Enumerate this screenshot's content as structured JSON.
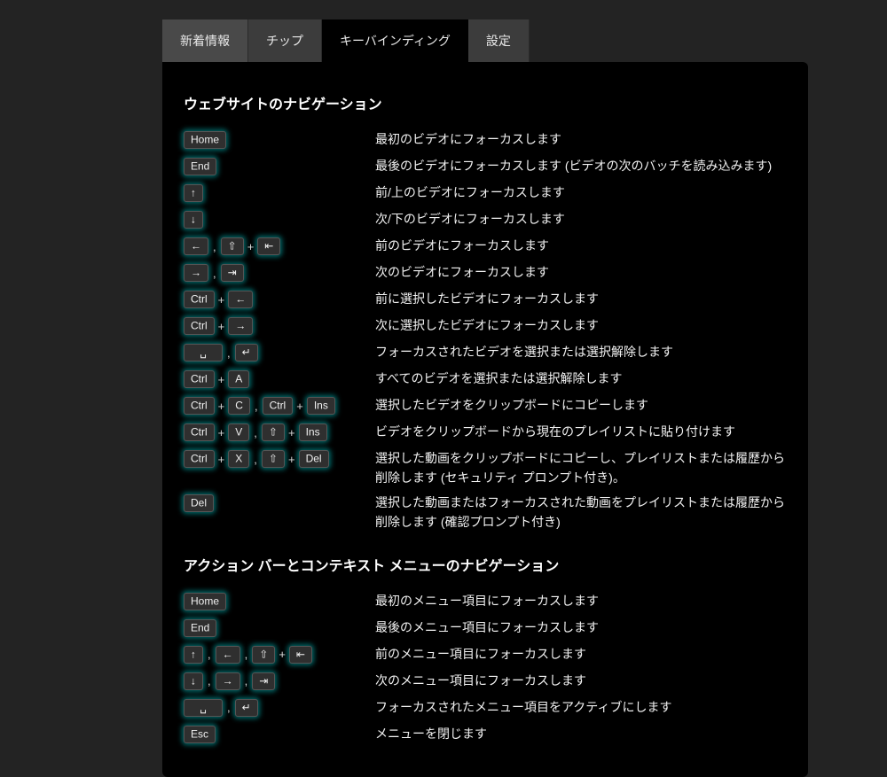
{
  "tabs": [
    {
      "label": "新着情報",
      "active": false
    },
    {
      "label": "チップ",
      "active": false
    },
    {
      "label": "キーバインディング",
      "active": true
    },
    {
      "label": "設定",
      "active": false
    }
  ],
  "sections": [
    {
      "title": "ウェブサイトのナビゲーション",
      "rows": [
        {
          "keys": [
            [
              "Home"
            ]
          ],
          "desc": "最初のビデオにフォーカスします"
        },
        {
          "keys": [
            [
              "End"
            ]
          ],
          "desc": "最後のビデオにフォーカスします (ビデオの次のバッチを読み込みます)"
        },
        {
          "keys": [
            [
              "↑"
            ]
          ],
          "desc": "前/上のビデオにフォーカスします"
        },
        {
          "keys": [
            [
              "↓"
            ]
          ],
          "desc": "次/下のビデオにフォーカスします"
        },
        {
          "keys": [
            [
              "←"
            ],
            [
              "⇧",
              "⇤"
            ]
          ],
          "desc": "前のビデオにフォーカスします"
        },
        {
          "keys": [
            [
              "→"
            ],
            [
              "⇥"
            ]
          ],
          "desc": "次のビデオにフォーカスします"
        },
        {
          "keys": [
            [
              "Ctrl",
              "←"
            ]
          ],
          "desc": "前に選択したビデオにフォーカスします"
        },
        {
          "keys": [
            [
              "Ctrl",
              "→"
            ]
          ],
          "desc": "次に選択したビデオにフォーカスします"
        },
        {
          "keys": [
            [
              "␣"
            ],
            [
              "↵"
            ]
          ],
          "desc": "フォーカスされたビデオを選択または選択解除します"
        },
        {
          "keys": [
            [
              "Ctrl",
              "A"
            ]
          ],
          "desc": "すべてのビデオを選択または選択解除します"
        },
        {
          "keys": [
            [
              "Ctrl",
              "C"
            ],
            [
              "Ctrl",
              "Ins"
            ]
          ],
          "desc": "選択したビデオをクリップボードにコピーします"
        },
        {
          "keys": [
            [
              "Ctrl",
              "V"
            ],
            [
              "⇧",
              "Ins"
            ]
          ],
          "desc": "ビデオをクリップボードから現在のプレイリストに貼り付けます"
        },
        {
          "keys": [
            [
              "Ctrl",
              "X"
            ],
            [
              "⇧",
              "Del"
            ]
          ],
          "desc": "選択した動画をクリップボードにコピーし、プレイリストまたは履歴から削除します (セキュリティ プロンプト付き)。"
        },
        {
          "keys": [
            [
              "Del"
            ]
          ],
          "desc": "選択した動画またはフォーカスされた動画をプレイリストまたは履歴から削除します (確認プロンプト付き)"
        }
      ]
    },
    {
      "title": "アクション バーとコンテキスト メニューのナビゲーション",
      "rows": [
        {
          "keys": [
            [
              "Home"
            ]
          ],
          "desc": "最初のメニュー項目にフォーカスします"
        },
        {
          "keys": [
            [
              "End"
            ]
          ],
          "desc": "最後のメニュー項目にフォーカスします"
        },
        {
          "keys": [
            [
              "↑"
            ],
            [
              "←"
            ],
            [
              "⇧",
              "⇤"
            ]
          ],
          "desc": "前のメニュー項目にフォーカスします"
        },
        {
          "keys": [
            [
              "↓"
            ],
            [
              "→"
            ],
            [
              "⇥"
            ]
          ],
          "desc": "次のメニュー項目にフォーカスします"
        },
        {
          "keys": [
            [
              "␣"
            ],
            [
              "↵"
            ]
          ],
          "desc": "フォーカスされたメニュー項目をアクティブにします"
        },
        {
          "keys": [
            [
              "Esc"
            ]
          ],
          "desc": "メニューを閉じます"
        }
      ]
    }
  ],
  "glyphs": {
    "separator": ",",
    "joiner": "+"
  }
}
